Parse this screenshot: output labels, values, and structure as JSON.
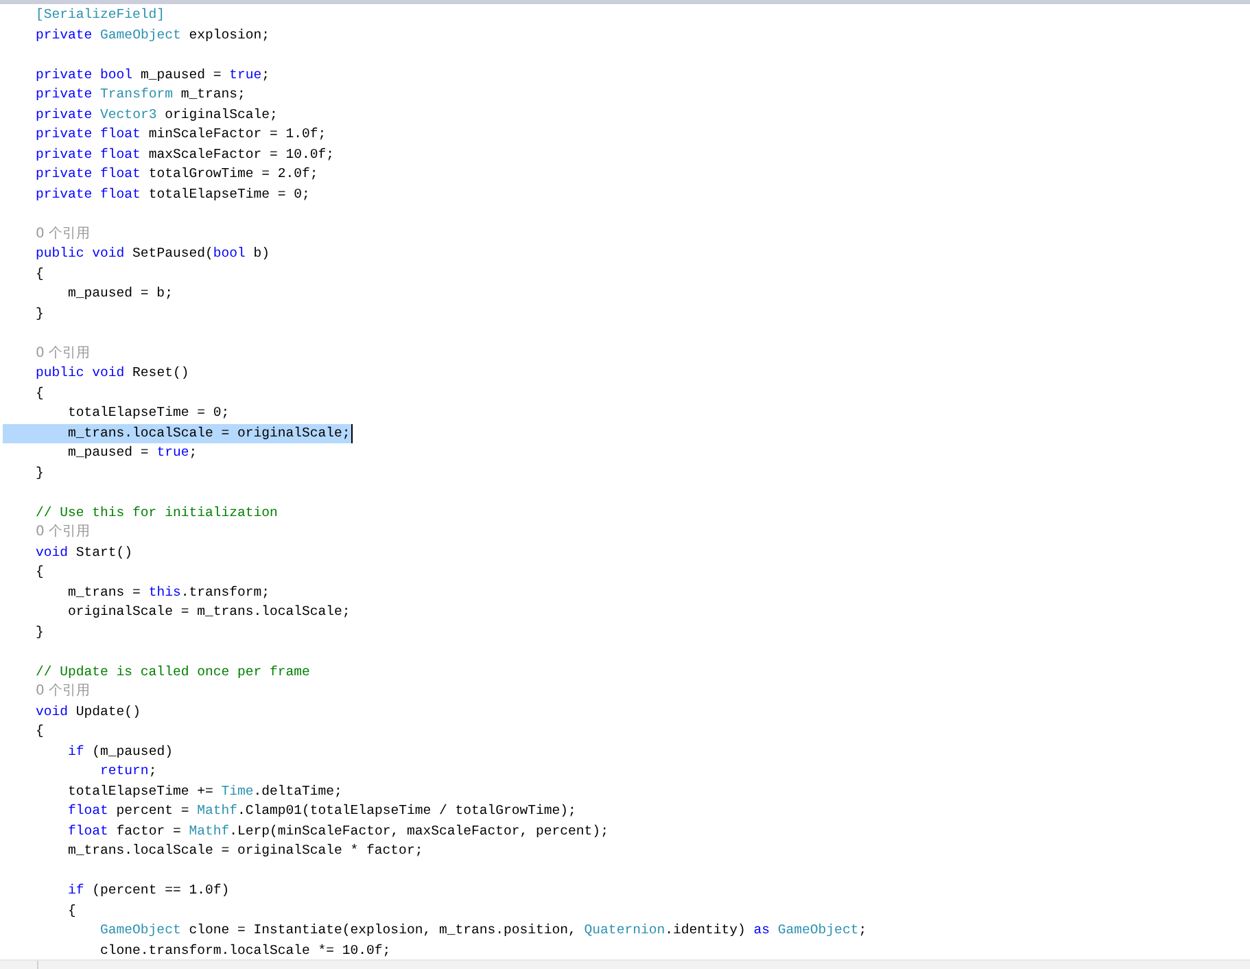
{
  "editor": {
    "lines": [
      {
        "kind": "code",
        "selected": false,
        "tokens": [
          {
            "kind": "type",
            "text": "[SerializeField]"
          }
        ]
      },
      {
        "kind": "code",
        "selected": false,
        "tokens": [
          {
            "kind": "kw",
            "text": "private "
          },
          {
            "kind": "type",
            "text": "GameObject"
          },
          {
            "kind": "plain",
            "text": " explosion;"
          }
        ]
      },
      {
        "kind": "blank"
      },
      {
        "kind": "code",
        "selected": false,
        "tokens": [
          {
            "kind": "kw",
            "text": "private bool"
          },
          {
            "kind": "plain",
            "text": " m_paused = "
          },
          {
            "kind": "kw",
            "text": "true"
          },
          {
            "kind": "plain",
            "text": ";"
          }
        ]
      },
      {
        "kind": "code",
        "selected": false,
        "tokens": [
          {
            "kind": "kw",
            "text": "private "
          },
          {
            "kind": "type",
            "text": "Transform"
          },
          {
            "kind": "plain",
            "text": " m_trans;"
          }
        ]
      },
      {
        "kind": "code",
        "selected": false,
        "tokens": [
          {
            "kind": "kw",
            "text": "private "
          },
          {
            "kind": "type",
            "text": "Vector3"
          },
          {
            "kind": "plain",
            "text": " originalScale;"
          }
        ]
      },
      {
        "kind": "code",
        "selected": false,
        "tokens": [
          {
            "kind": "kw",
            "text": "private float"
          },
          {
            "kind": "plain",
            "text": " minScaleFactor = 1.0f;"
          }
        ]
      },
      {
        "kind": "code",
        "selected": false,
        "tokens": [
          {
            "kind": "kw",
            "text": "private float"
          },
          {
            "kind": "plain",
            "text": " maxScaleFactor = 10.0f;"
          }
        ]
      },
      {
        "kind": "code",
        "selected": false,
        "tokens": [
          {
            "kind": "kw",
            "text": "private float"
          },
          {
            "kind": "plain",
            "text": " totalGrowTime = 2.0f;"
          }
        ]
      },
      {
        "kind": "code",
        "selected": false,
        "tokens": [
          {
            "kind": "kw",
            "text": "private float"
          },
          {
            "kind": "plain",
            "text": " totalElapseTime = 0;"
          }
        ]
      },
      {
        "kind": "blank"
      },
      {
        "kind": "lens",
        "text": "0 个引用"
      },
      {
        "kind": "code",
        "selected": false,
        "tokens": [
          {
            "kind": "kw",
            "text": "public void"
          },
          {
            "kind": "plain",
            "text": " SetPaused("
          },
          {
            "kind": "kw",
            "text": "bool"
          },
          {
            "kind": "plain",
            "text": " b)"
          }
        ]
      },
      {
        "kind": "code",
        "selected": false,
        "tokens": [
          {
            "kind": "plain",
            "text": "{"
          }
        ]
      },
      {
        "kind": "code",
        "selected": false,
        "tokens": [
          {
            "kind": "plain",
            "text": "    m_paused = b;"
          }
        ]
      },
      {
        "kind": "code",
        "selected": false,
        "tokens": [
          {
            "kind": "plain",
            "text": "}"
          }
        ]
      },
      {
        "kind": "blank"
      },
      {
        "kind": "lens",
        "text": "0 个引用"
      },
      {
        "kind": "code",
        "selected": false,
        "tokens": [
          {
            "kind": "kw",
            "text": "public void"
          },
          {
            "kind": "plain",
            "text": " Reset()"
          }
        ]
      },
      {
        "kind": "code",
        "selected": false,
        "tokens": [
          {
            "kind": "plain",
            "text": "{"
          }
        ]
      },
      {
        "kind": "code",
        "selected": false,
        "tokens": [
          {
            "kind": "plain",
            "text": "    totalElapseTime = 0;"
          }
        ]
      },
      {
        "kind": "code",
        "selected": true,
        "tokens": [
          {
            "kind": "plain",
            "text": "    m_trans.localScale = originalScale;"
          }
        ]
      },
      {
        "kind": "code",
        "selected": false,
        "tokens": [
          {
            "kind": "plain",
            "text": "    m_paused = "
          },
          {
            "kind": "kw",
            "text": "true"
          },
          {
            "kind": "plain",
            "text": ";"
          }
        ]
      },
      {
        "kind": "code",
        "selected": false,
        "tokens": [
          {
            "kind": "plain",
            "text": "}"
          }
        ]
      },
      {
        "kind": "blank"
      },
      {
        "kind": "code",
        "selected": false,
        "tokens": [
          {
            "kind": "comment",
            "text": "// Use this for initialization"
          }
        ]
      },
      {
        "kind": "lens",
        "text": "0 个引用"
      },
      {
        "kind": "code",
        "selected": false,
        "tokens": [
          {
            "kind": "kw",
            "text": "void"
          },
          {
            "kind": "plain",
            "text": " Start()"
          }
        ]
      },
      {
        "kind": "code",
        "selected": false,
        "tokens": [
          {
            "kind": "plain",
            "text": "{"
          }
        ]
      },
      {
        "kind": "code",
        "selected": false,
        "tokens": [
          {
            "kind": "plain",
            "text": "    m_trans = "
          },
          {
            "kind": "kw",
            "text": "this"
          },
          {
            "kind": "plain",
            "text": ".transform;"
          }
        ]
      },
      {
        "kind": "code",
        "selected": false,
        "tokens": [
          {
            "kind": "plain",
            "text": "    originalScale = m_trans.localScale;"
          }
        ]
      },
      {
        "kind": "code",
        "selected": false,
        "tokens": [
          {
            "kind": "plain",
            "text": "}"
          }
        ]
      },
      {
        "kind": "blank"
      },
      {
        "kind": "code",
        "selected": false,
        "tokens": [
          {
            "kind": "comment",
            "text": "// Update is called once per frame"
          }
        ]
      },
      {
        "kind": "lens",
        "text": "0 个引用"
      },
      {
        "kind": "code",
        "selected": false,
        "tokens": [
          {
            "kind": "kw",
            "text": "void"
          },
          {
            "kind": "plain",
            "text": " Update()"
          }
        ]
      },
      {
        "kind": "code",
        "selected": false,
        "tokens": [
          {
            "kind": "plain",
            "text": "{"
          }
        ]
      },
      {
        "kind": "code",
        "selected": false,
        "tokens": [
          {
            "kind": "kw",
            "text": "    if"
          },
          {
            "kind": "plain",
            "text": " (m_paused)"
          }
        ]
      },
      {
        "kind": "code",
        "selected": false,
        "tokens": [
          {
            "kind": "kw",
            "text": "        return"
          },
          {
            "kind": "plain",
            "text": ";"
          }
        ]
      },
      {
        "kind": "code",
        "selected": false,
        "tokens": [
          {
            "kind": "plain",
            "text": "    totalElapseTime += "
          },
          {
            "kind": "type",
            "text": "Time"
          },
          {
            "kind": "plain",
            "text": ".deltaTime;"
          }
        ]
      },
      {
        "kind": "code",
        "selected": false,
        "tokens": [
          {
            "kind": "kw",
            "text": "    float"
          },
          {
            "kind": "plain",
            "text": " percent = "
          },
          {
            "kind": "type",
            "text": "Mathf"
          },
          {
            "kind": "plain",
            "text": ".Clamp01(totalElapseTime / totalGrowTime);"
          }
        ]
      },
      {
        "kind": "code",
        "selected": false,
        "tokens": [
          {
            "kind": "kw",
            "text": "    float"
          },
          {
            "kind": "plain",
            "text": " factor = "
          },
          {
            "kind": "type",
            "text": "Mathf"
          },
          {
            "kind": "plain",
            "text": ".Lerp(minScaleFactor, maxScaleFactor, percent);"
          }
        ]
      },
      {
        "kind": "code",
        "selected": false,
        "tokens": [
          {
            "kind": "plain",
            "text": "    m_trans.localScale = originalScale * factor;"
          }
        ]
      },
      {
        "kind": "blank"
      },
      {
        "kind": "code",
        "selected": false,
        "tokens": [
          {
            "kind": "kw",
            "text": "    if"
          },
          {
            "kind": "plain",
            "text": " (percent == 1.0f)"
          }
        ]
      },
      {
        "kind": "code",
        "selected": false,
        "tokens": [
          {
            "kind": "plain",
            "text": "    {"
          }
        ]
      },
      {
        "kind": "code",
        "selected": false,
        "tokens": [
          {
            "kind": "type",
            "text": "        GameObject"
          },
          {
            "kind": "plain",
            "text": " clone = Instantiate(explosion, m_trans.position, "
          },
          {
            "kind": "type",
            "text": "Quaternion"
          },
          {
            "kind": "plain",
            "text": ".identity) "
          },
          {
            "kind": "kw",
            "text": "as "
          },
          {
            "kind": "type",
            "text": "GameObject"
          },
          {
            "kind": "plain",
            "text": ";"
          }
        ]
      },
      {
        "kind": "code",
        "selected": false,
        "tokens": [
          {
            "kind": "plain",
            "text": "        clone.transform.localScale *= 10.0f;"
          }
        ]
      }
    ]
  }
}
